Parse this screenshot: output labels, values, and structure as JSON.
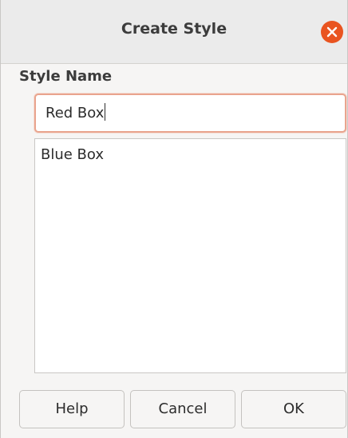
{
  "dialog": {
    "title": "Create Style",
    "close_icon": "close-icon",
    "accent_color": "#e95420"
  },
  "form": {
    "section_label": "Style Name",
    "name_value": "Red Box"
  },
  "styles_list": {
    "items": [
      "Blue Box"
    ]
  },
  "buttons": {
    "help_label": "Help",
    "cancel_label": "Cancel",
    "ok_label": "OK"
  }
}
